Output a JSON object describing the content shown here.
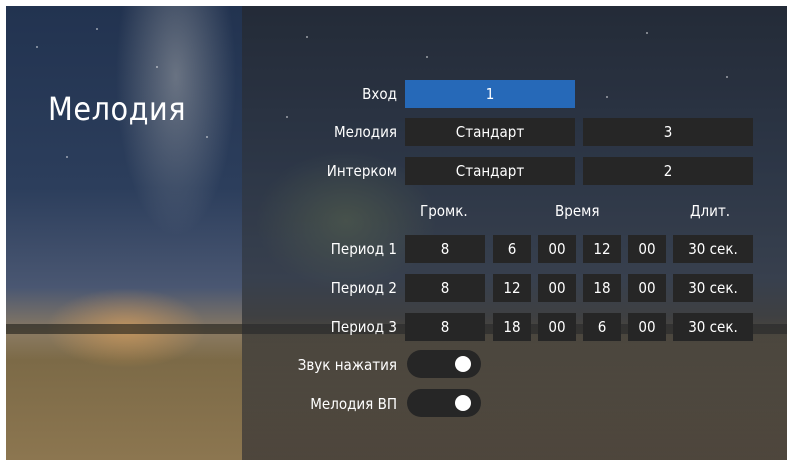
{
  "title": "Мелодия",
  "labels": {
    "input": "Вход",
    "melody": "Мелодия",
    "intercom": "Интерком",
    "period1": "Период 1",
    "period2": "Период 2",
    "period3": "Период 3",
    "key_sound": "Звук нажатия",
    "melody_vp": "Мелодия ВП"
  },
  "headers": {
    "volume": "Громк.",
    "time": "Время",
    "duration": "Длит."
  },
  "input_value": "1",
  "melody": {
    "name": "Стандарт",
    "volume": "3"
  },
  "intercom": {
    "name": "Стандарт",
    "volume": "2"
  },
  "periods": [
    {
      "volume": "8",
      "start_h": "6",
      "start_m": "00",
      "end_h": "12",
      "end_m": "00",
      "duration": "30 сек."
    },
    {
      "volume": "8",
      "start_h": "12",
      "start_m": "00",
      "end_h": "18",
      "end_m": "00",
      "duration": "30 сек."
    },
    {
      "volume": "8",
      "start_h": "18",
      "start_m": "00",
      "end_h": "6",
      "end_m": "00",
      "duration": "30 сек."
    }
  ],
  "toggles": {
    "key_sound": true,
    "melody_vp": true
  }
}
